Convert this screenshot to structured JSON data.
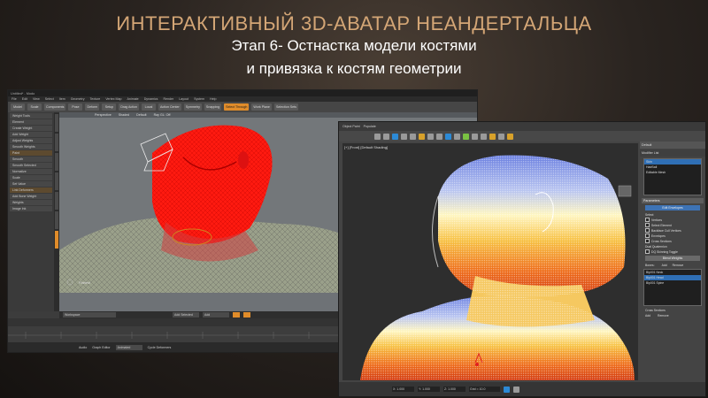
{
  "slide": {
    "title_line1": "ИНТЕРАКТИВНЫЙ 3D-АВАТАР НЕАНДЕРТАЛЬЦА",
    "title_line2": "Этап 6- Остнастка модели костями",
    "title_line3": "и привязка к костям геометрии"
  },
  "colors": {
    "title_accent": "#d4a676",
    "modo_active": "#e08c2a",
    "max_selection": "#2f6fb5",
    "weight_red": "#ff1a10"
  },
  "left_window": {
    "title": "Untitled* - Modo",
    "menu": [
      "File",
      "Edit",
      "View",
      "Select",
      "Item",
      "Geometry",
      "Texture",
      "Vertex Map",
      "Animate",
      "Dynamics",
      "Render",
      "Layout",
      "System",
      "Help"
    ],
    "toolbar": [
      "Model",
      "Scale",
      "Components",
      "Pose",
      "Deform",
      "Setup",
      "Drag Action",
      "Local",
      "Action Center",
      "Symmetry",
      "Snapping",
      "Select Through",
      "Work Plane",
      "Selection Sets"
    ],
    "toolbar_active": "Select Through",
    "side_items": [
      "Weight Tools",
      "Element",
      "Create Weight",
      "Add Weight",
      "Adjust Weights",
      "Smooth Weights",
      "Paint",
      "Smooth",
      "Smooth Selected",
      "Normalize",
      "Scale",
      "Set Value",
      "Link Deformers",
      "Add Bone Weight",
      "Weights",
      "Image Ink"
    ],
    "viewport_header": [
      "Perspective",
      "Shaded",
      "Default",
      "Ray GL: Off"
    ],
    "viewport_label": "Flattest",
    "bottom_bar": [
      "Workspace",
      "Add Selected",
      "Add"
    ],
    "status": [
      "Audio",
      "Graph Editor",
      "Animated",
      "Cycle Deformers"
    ]
  },
  "right_window": {
    "ribbon": [
      "Object Paint",
      "Populate"
    ],
    "viewport_label": "[+] [Front] [Default Shading]",
    "command_panel": {
      "object_name": "Default",
      "modifier_label": "Modifier List",
      "stack": [
        "Skin",
        "HairBall",
        "Editable Mesh"
      ],
      "stack_selected": "Skin",
      "parameters_label": "Parameters",
      "edit_envelopes": "Edit Envelopes",
      "select_label": "Select",
      "checks": [
        "Vertices",
        "Select Element",
        "Backface Cull Vertices",
        "Envelopes",
        "Cross Sections"
      ],
      "dual_quaternion": "Dual Quaternion",
      "dq_skinning": "DQ Skinning Toggle",
      "blend_weights": "Blend Weights",
      "bones_label": "Bones:",
      "add_label": "Add",
      "remove_label": "Remove",
      "bones_list": [
        "Bip001 Neck",
        "Bip001 Head",
        "Bip001 Spine"
      ],
      "bones_selected": "Bip001 Head",
      "cross_sections": "Cross Sections",
      "cs_add": "Add",
      "cs_remove": "Remove"
    },
    "status_fields": [
      "X: 1.000",
      "Y: 1.000",
      "Z: 1.000",
      "Grid = 10.0"
    ]
  }
}
